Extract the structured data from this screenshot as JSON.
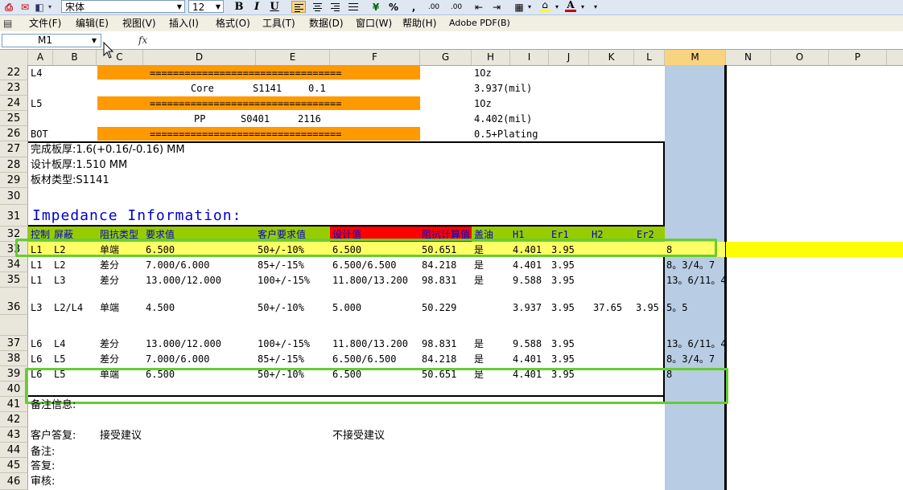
{
  "toolbar": {
    "font_name": "宋体",
    "font_size": "12",
    "bold": "B",
    "italic": "I",
    "underline": "U",
    "percent": "%",
    "comma": ",",
    "dec_increase": ".00",
    "dec_decrease": ".00",
    "font_color": "#cc0000",
    "fill_color": "#ffff00"
  },
  "menu": [
    "文件(F)",
    "编辑(E)",
    "视图(V)",
    "插入(I)",
    "格式(O)",
    "工具(T)",
    "数据(D)",
    "窗口(W)",
    "帮助(H)",
    "Adobe PDF(B)"
  ],
  "formula": {
    "name_box": "M1",
    "fx": "fx",
    "value": ""
  },
  "columns": [
    "A",
    "B",
    "C",
    "D",
    "E",
    "F",
    "G",
    "H",
    "I",
    "J",
    "K",
    "L",
    "M",
    "N",
    "O",
    "P"
  ],
  "selected_column": "M",
  "rows": [
    "22",
    "23",
    "24",
    "25",
    "26",
    "27",
    "28",
    "29",
    "30",
    "31",
    "32",
    "33",
    "34",
    "35",
    "36",
    "",
    "37",
    "38",
    "39",
    "40",
    "41",
    "42",
    "43",
    "44",
    "45",
    "46"
  ],
  "stackup": {
    "r22_label": "L4",
    "r22_bar": "=================================",
    "r22_h": "1Oz",
    "r23_d": "Core",
    "r23_e": "S1141",
    "r23_e2": "0.1",
    "r23_h": "3.937(mil)",
    "r24_label": "L5",
    "r24_bar": "=================================",
    "r24_h": "1Oz",
    "r25_d": "PP",
    "r25_e": "S0401",
    "r25_e2": "2116",
    "r25_h": "4.402(mil)",
    "r26_label": "BOT",
    "r26_bar": "=================================",
    "r26_h": "0.5+Plating"
  },
  "info": {
    "finished": "完成板厚:1.6(+0.16/-0.16) MM",
    "design": "设计板厚:1.510 MM",
    "material": "板材类型:S1141",
    "impedance_title": "Impedance Information:"
  },
  "table_headers": {
    "ctrl": "控制",
    "shield": "屏蔽",
    "type": "阻抗类型",
    "req": "要求值",
    "cust": "客户要求值",
    "design": "设计值",
    "calc": "阻抗计算值",
    "mask": "盖油",
    "h1": "H1",
    "er1": "Er1",
    "h2": "H2",
    "er2": "Er2"
  },
  "table_rows": [
    {
      "ctrl": "L1",
      "shield": "L2",
      "type": "单端",
      "req": "6.500",
      "cust": "50+/-10%",
      "design": "6.500",
      "calc": "50.651",
      "mask": "是",
      "h1": "4.401",
      "er1": "3.95",
      "h2": "",
      "er2": "",
      "m": "8"
    },
    {
      "ctrl": "L1",
      "shield": "L2",
      "type": "差分",
      "req": "7.000/6.000",
      "cust": "85+/-15%",
      "design": "6.500/6.500",
      "calc": "84.218",
      "mask": "是",
      "h1": "4.401",
      "er1": "3.95",
      "h2": "",
      "er2": "",
      "m": "8。3/4。7"
    },
    {
      "ctrl": "L1",
      "shield": "L3",
      "type": "差分",
      "req": "13.000/12.000",
      "cust": "100+/-15%",
      "design": "11.800/13.200",
      "calc": "98.831",
      "mask": "是",
      "h1": "9.588",
      "er1": "3.95",
      "h2": "",
      "er2": "",
      "m": "13。6/11。4"
    },
    {
      "ctrl": "L3",
      "shield": "L2/L4",
      "type": "单端",
      "req": "4.500",
      "cust": "50+/-10%",
      "design": "5.000",
      "calc": "50.229",
      "mask": "",
      "h1": "3.937",
      "er1": "3.95",
      "h2": "37.65",
      "er2": "3.95",
      "m": "5。5"
    },
    {
      "ctrl": "L6",
      "shield": "L4",
      "type": "差分",
      "req": "13.000/12.000",
      "cust": "100+/-15%",
      "design": "11.800/13.200",
      "calc": "98.831",
      "mask": "是",
      "h1": "9.588",
      "er1": "3.95",
      "h2": "",
      "er2": "",
      "m": "13。6/11。4"
    },
    {
      "ctrl": "L6",
      "shield": "L5",
      "type": "差分",
      "req": "7.000/6.000",
      "cust": "85+/-15%",
      "design": "6.500/6.500",
      "calc": "84.218",
      "mask": "是",
      "h1": "4.401",
      "er1": "3.95",
      "h2": "",
      "er2": "",
      "m": "8。3/4。7"
    },
    {
      "ctrl": "L6",
      "shield": "L5",
      "type": "单端",
      "req": "6.500",
      "cust": "50+/-10%",
      "design": "6.500",
      "calc": "50.651",
      "mask": "是",
      "h1": "4.401",
      "er1": "3.95",
      "h2": "",
      "er2": "",
      "m": "8"
    }
  ],
  "notes": {
    "remark_info": "备注信息:",
    "customer_reply": "客户答复:",
    "accept": "接受建议",
    "reject": "不接受建议",
    "remark": "备注:",
    "reply": "答复:",
    "review": "审核:"
  },
  "colors": {
    "orange": "#ff9900",
    "header_bg": "#99cc00",
    "design_header": "#ff0000",
    "highlight_row": "#ffff66",
    "green_box": "#66cc33",
    "title_blue": "#0000cc",
    "selected_col": "#b8cce4"
  }
}
